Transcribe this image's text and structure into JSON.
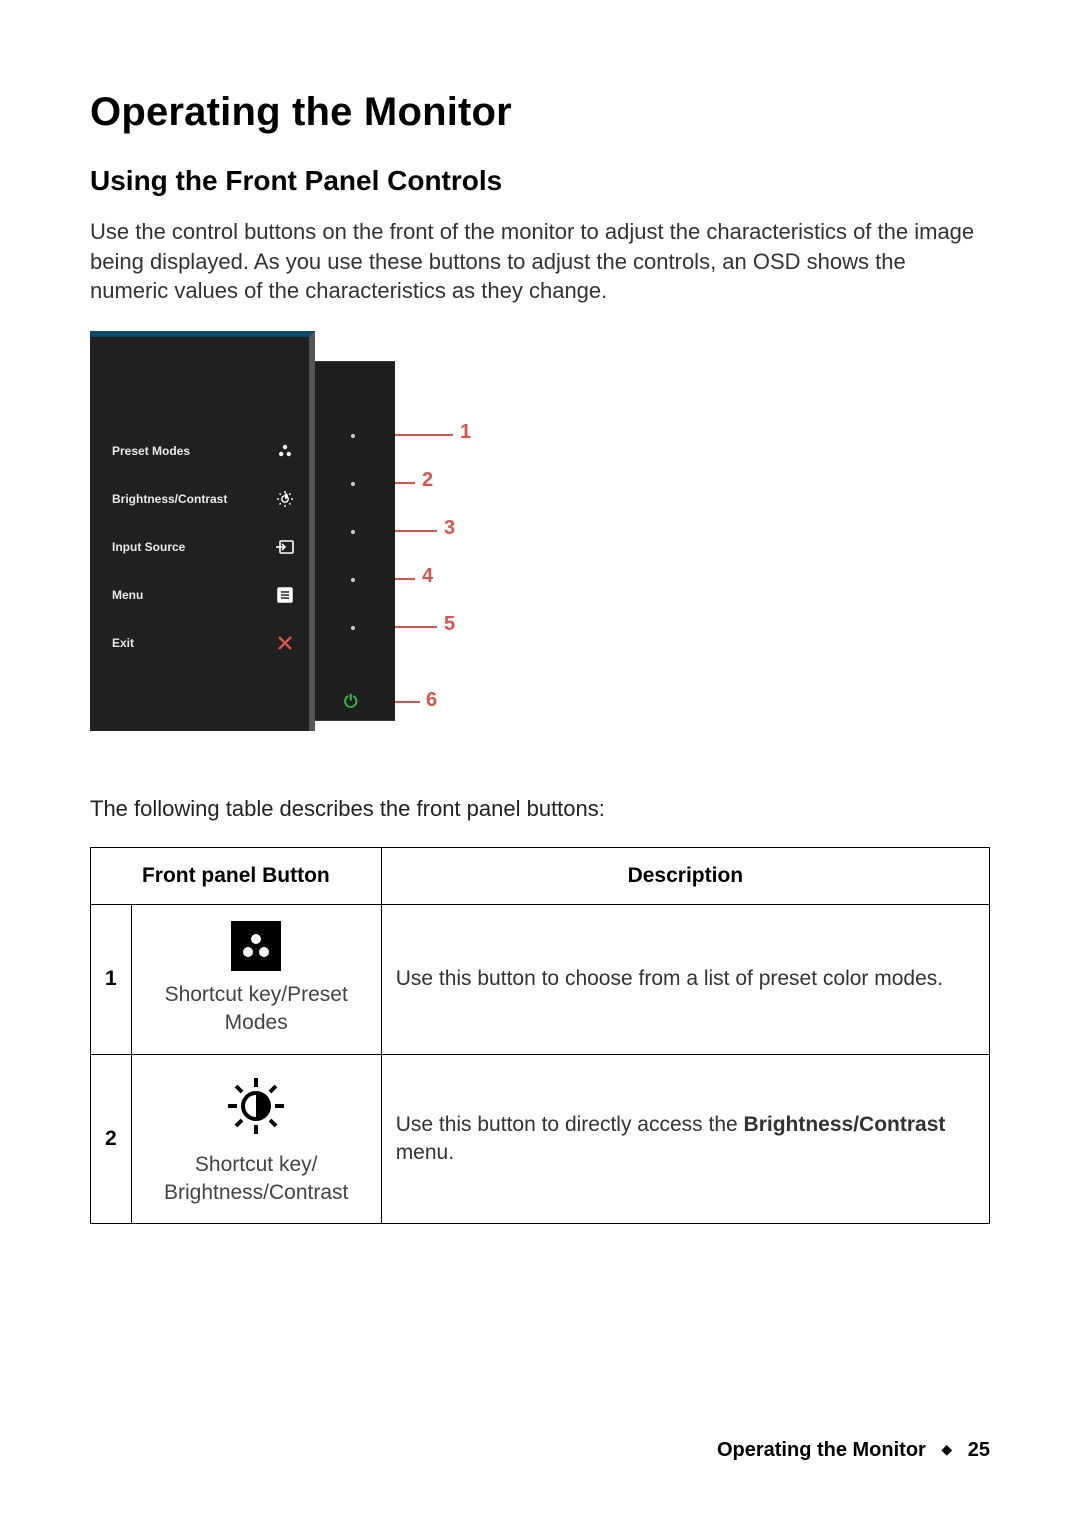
{
  "title": "Operating the Monitor",
  "subtitle": "Using the Front Panel Controls",
  "intro": "Use the control buttons on the front of the monitor to adjust the characteristics of the image being displayed. As you use these buttons to adjust the controls, an OSD shows the numeric values of the characteristics as they change.",
  "osd": {
    "items": [
      {
        "label": "Preset Modes",
        "icon": "preset-icon"
      },
      {
        "label": "Brightness/Contrast",
        "icon": "brightness-icon"
      },
      {
        "label": "Input Source",
        "icon": "input-icon"
      },
      {
        "label": "Menu",
        "icon": "menu-icon"
      },
      {
        "label": "Exit",
        "icon": "close-icon"
      }
    ],
    "callouts": [
      "1",
      "2",
      "3",
      "4",
      "5",
      "6"
    ]
  },
  "table_lead": "The following table describes the front panel buttons:",
  "table": {
    "headers": {
      "col1": "Front panel Button",
      "col2": "Description"
    },
    "rows": [
      {
        "num": "1",
        "icon_label": "Shortcut key/Preset Modes",
        "desc": "Use this button to choose from a list of preset color modes."
      },
      {
        "num": "2",
        "icon_label": "Shortcut key/ Brightness/Contrast",
        "desc_pre": "Use this button to directly access the ",
        "desc_bold": "Brightness/Contrast",
        "desc_post": " menu."
      }
    ]
  },
  "footer": {
    "title": "Operating the Monitor",
    "page": "25"
  }
}
